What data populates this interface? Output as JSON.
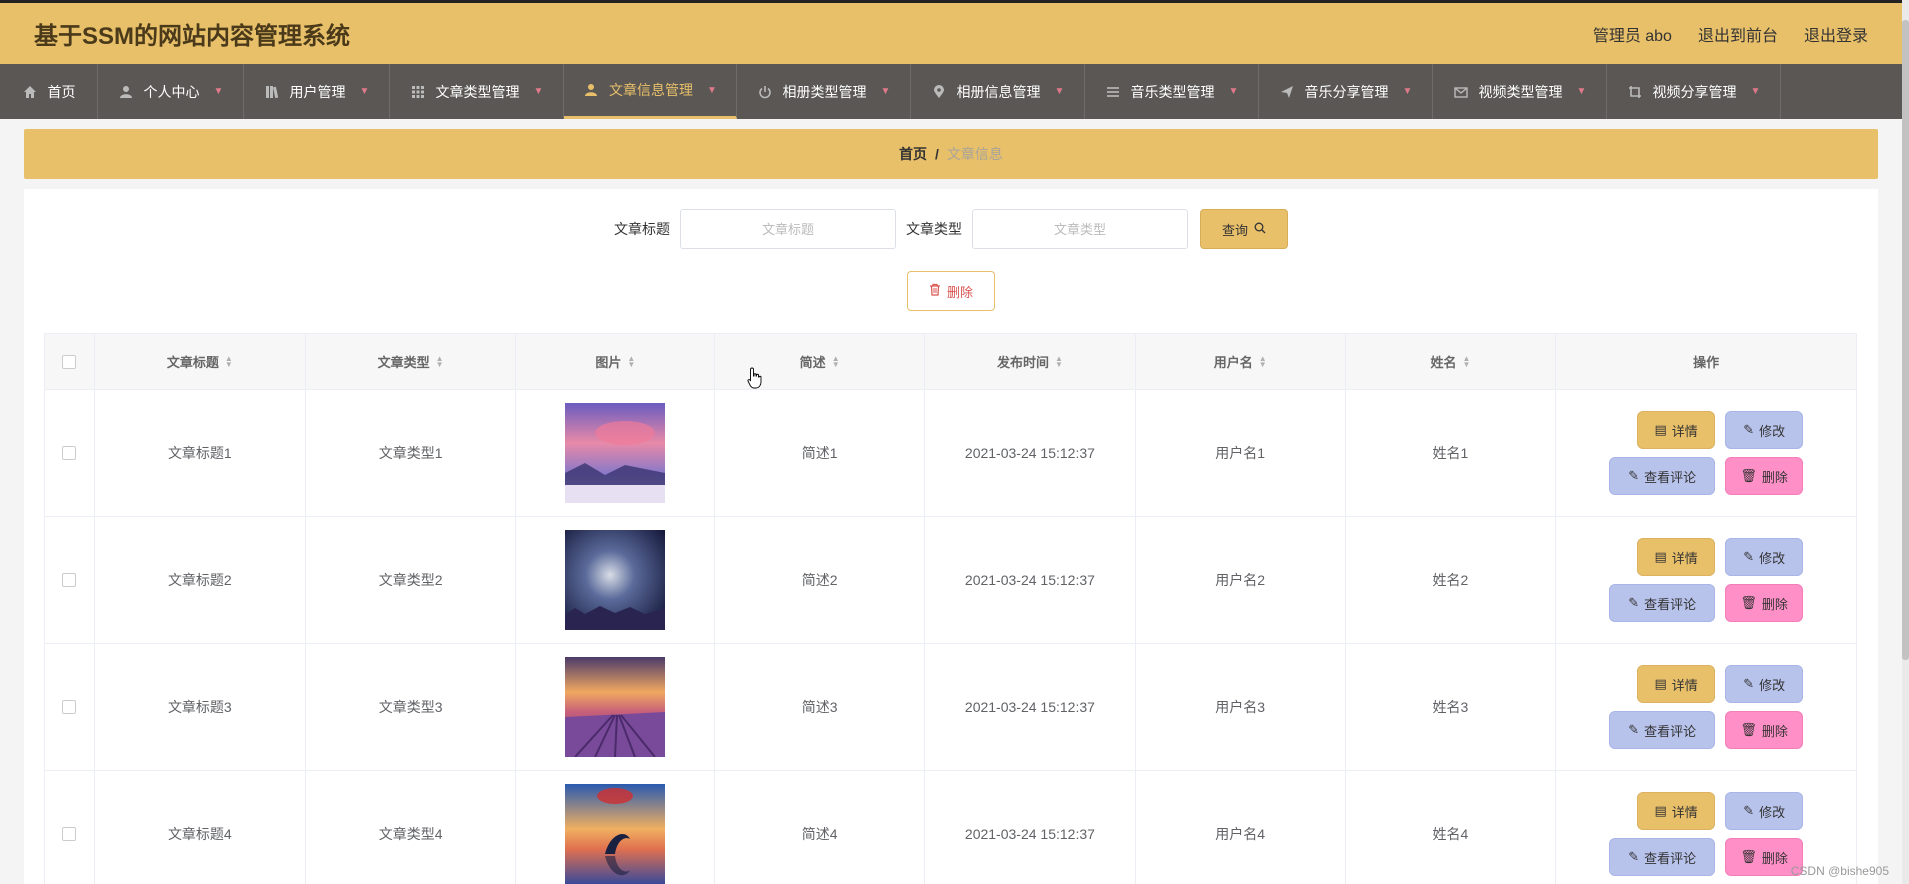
{
  "app": {
    "title": "基于SSM的网站内容管理系统"
  },
  "top_actions": {
    "admin": "管理员 abo",
    "to_front": "退出到前台",
    "logout": "退出登录"
  },
  "nav": [
    {
      "label": "首页",
      "icon": "home-icon",
      "active": false
    },
    {
      "label": "个人中心",
      "icon": "user-icon",
      "active": false
    },
    {
      "label": "用户管理",
      "icon": "book-icon",
      "active": false
    },
    {
      "label": "文章类型管理",
      "icon": "grid-icon",
      "active": false
    },
    {
      "label": "文章信息管理",
      "icon": "user-icon",
      "active": true
    },
    {
      "label": "相册类型管理",
      "icon": "power-icon",
      "active": false
    },
    {
      "label": "相册信息管理",
      "icon": "location-pin-icon",
      "active": false
    },
    {
      "label": "音乐类型管理",
      "icon": "list-icon",
      "active": false
    },
    {
      "label": "音乐分享管理",
      "icon": "send-icon",
      "active": false
    },
    {
      "label": "视频类型管理",
      "icon": "mail-icon",
      "active": false
    },
    {
      "label": "视频分享管理",
      "icon": "crop-icon",
      "active": false
    }
  ],
  "breadcrumb": {
    "home": "首页",
    "sep": "/",
    "current": "文章信息"
  },
  "search": {
    "title_label": "文章标题",
    "title_placeholder": "文章标题",
    "type_label": "文章类型",
    "type_placeholder": "文章类型",
    "query_label": "查询"
  },
  "bulk": {
    "delete_label": "删除"
  },
  "table": {
    "headers": [
      "文章标题",
      "文章类型",
      "图片",
      "简述",
      "发布时间",
      "用户名",
      "姓名",
      "操作"
    ],
    "rows": [
      {
        "title": "文章标题1",
        "type": "文章类型1",
        "summary": "简述1",
        "time": "2021-03-24 15:12:37",
        "username": "用户名1",
        "name": "姓名1",
        "image": "purple-sunset-lake"
      },
      {
        "title": "文章标题2",
        "type": "文章类型2",
        "summary": "简述2",
        "time": "2021-03-24 15:12:37",
        "username": "用户名2",
        "name": "姓名2",
        "image": "night-sky-glow"
      },
      {
        "title": "文章标题3",
        "type": "文章类型3",
        "summary": "简述3",
        "time": "2021-03-24 15:12:37",
        "username": "用户名3",
        "name": "姓名3",
        "image": "lavender-field-sunset"
      },
      {
        "title": "文章标题4",
        "type": "文章类型4",
        "summary": "简述4",
        "time": "2021-03-24 15:12:37",
        "username": "用户名4",
        "name": "姓名4",
        "image": "dolphin-sunset"
      }
    ],
    "actions": {
      "detail": "详情",
      "edit": "修改",
      "comments": "查看评论",
      "delete": "删除"
    }
  },
  "colors": {
    "primary": "#e8c06a",
    "nav_bg": "#5a5755",
    "edit_btn": "#b8c3ec",
    "delete_btn": "#ff8fc7"
  },
  "watermark": "CSDN @bishe905"
}
